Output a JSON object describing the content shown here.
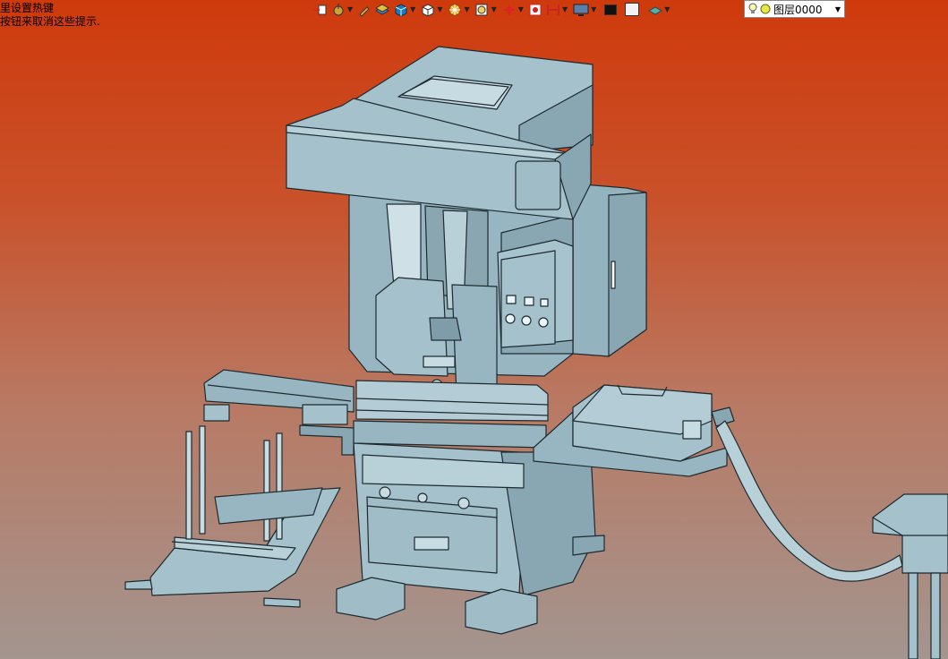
{
  "hint": {
    "line1": "里设置热键",
    "line2": "按钮来取消这些提示."
  },
  "toolbar": {
    "tools": [
      {
        "icon": "snap-icon",
        "dropdown": false
      },
      {
        "icon": "cursor-mode-icon",
        "dropdown": true
      },
      {
        "icon": "pen-icon",
        "dropdown": false
      },
      {
        "icon": "layer-cube-icon",
        "dropdown": false
      },
      {
        "icon": "solid-cube-icon",
        "dropdown": true
      },
      {
        "icon": "white-cube-icon",
        "dropdown": true
      },
      {
        "icon": "sun-render-icon",
        "dropdown": true
      },
      {
        "icon": "zoom-view-icon",
        "dropdown": true
      },
      {
        "icon": "crosshair-icon",
        "dropdown": true
      },
      {
        "icon": "capture-icon",
        "dropdown": false
      },
      {
        "icon": "section-icon",
        "dropdown": true
      },
      {
        "icon": "monitor-icon",
        "dropdown": true
      }
    ],
    "color_swatch_black": "#111111",
    "color_swatch_white": "#f2f2f2",
    "material_icon": "material-icon"
  },
  "layer": {
    "label": "图层0000",
    "lamp_icon": "bulb-icon",
    "state_icon": "layer-visible-icon"
  },
  "colors": {
    "model_fill": "#a4c1cc",
    "model_dark": "#88a7b3",
    "model_edge": "#1e2a30"
  }
}
